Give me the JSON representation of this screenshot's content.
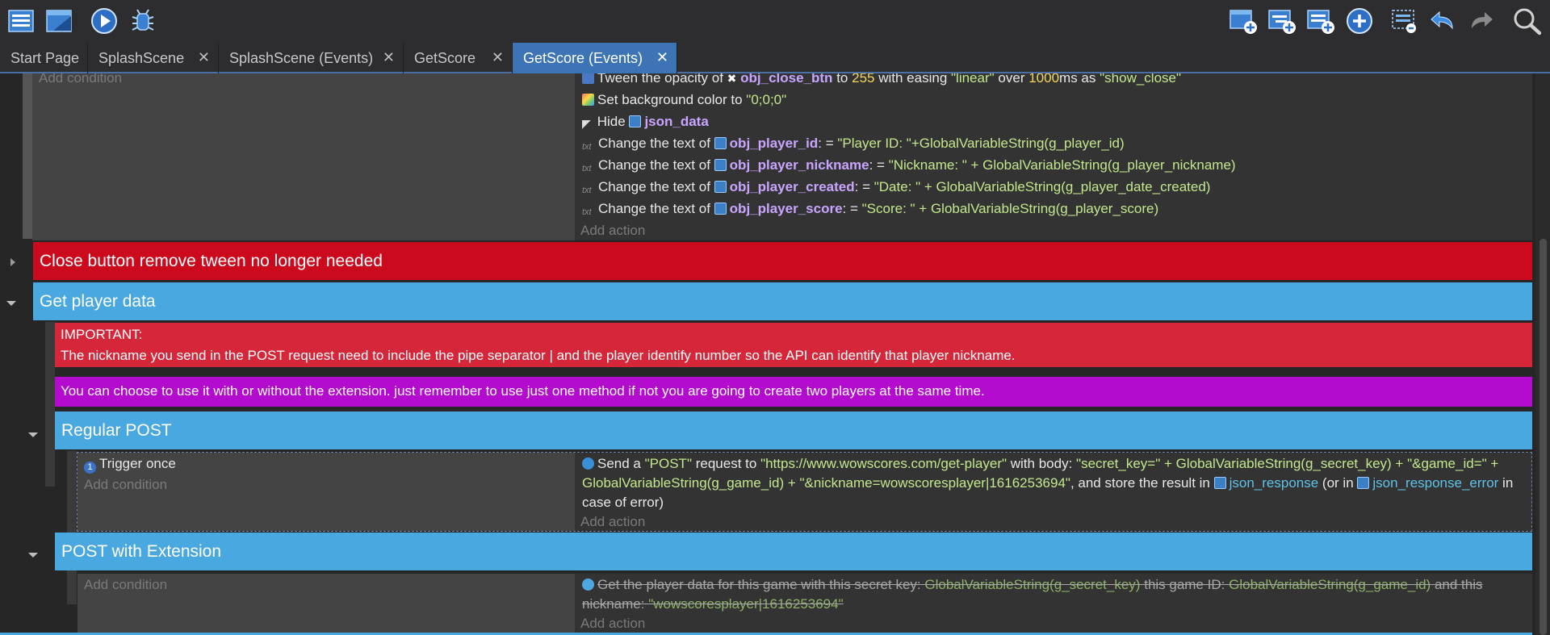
{
  "toolbar": {
    "left_icons": [
      "events-list-icon",
      "scene-window-icon",
      "play-preview-icon",
      "debug-bug-icon"
    ],
    "right_icons": [
      "add-event-icon",
      "add-subevent-icon",
      "add-other-icon",
      "add-plus-icon",
      "choose-block-icon",
      "undo-icon",
      "redo-icon",
      "search-icon"
    ]
  },
  "tabs": [
    {
      "label": "Start Page",
      "closable": false
    },
    {
      "label": "SplashScene",
      "closable": true
    },
    {
      "label": "SplashScene (Events)",
      "closable": true
    },
    {
      "label": "GetScore",
      "closable": true
    },
    {
      "label": "GetScore (Events)",
      "closable": true,
      "active": true
    }
  ],
  "tab_close_glyph": "✕",
  "colors": {
    "accent_tab": "#3c74b6",
    "group_red": "#cc0a1e",
    "group_blue": "#4aa8e0",
    "comment_red": "#d62639",
    "comment_purple": "#b40ccf"
  },
  "events": {
    "top_event": {
      "add_condition": "Add condition",
      "add_action": "Add action",
      "actions": [
        {
          "icon": "tween-icon",
          "prefix": "Tween the opacity of",
          "object_icon": "close-x-icon",
          "object": "obj_close_btn",
          "mid1": "to",
          "value": "255",
          "mid2": "with easing",
          "easing": "\"linear\"",
          "mid3": "over",
          "duration": "1000",
          "mid4": "ms as",
          "id": "\"show_close\""
        },
        {
          "icon": "color-icon",
          "prefix": "Set background color to",
          "value": "\"0;0;0\""
        },
        {
          "icon": "hide-icon",
          "prefix": "Hide",
          "object": "json_data"
        },
        {
          "icon": "text-icon",
          "prefix": "Change the text of",
          "object": "obj_player_id",
          "op": ": =",
          "value": "\"Player ID: \"+GlobalVariableString(g_player_id)"
        },
        {
          "icon": "text-icon",
          "prefix": "Change the text of",
          "object": "obj_player_nickname",
          "op": ": =",
          "value": "\"Nickname: \" + GlobalVariableString(g_player_nickname)"
        },
        {
          "icon": "text-icon",
          "prefix": "Change the text of",
          "object": "obj_player_created",
          "op": ": =",
          "value": "\"Date: \" + GlobalVariableString(g_player_date_created)"
        },
        {
          "icon": "text-icon",
          "prefix": "Change the text of",
          "object": "obj_player_score",
          "op": ": =",
          "value": "\"Score: \" + GlobalVariableString(g_player_score)"
        }
      ]
    },
    "group_close": {
      "title": "Close button remove tween no longer needed"
    },
    "group_get": {
      "title": "Get player data"
    },
    "comment_important": {
      "line1": "IMPORTANT:",
      "line2": "The nickname you send in the POST request need to include the pipe separator | and the player identify number so the API can identify that player nickname."
    },
    "comment_choose": {
      "text": "You can choose to use it with or without the extension. just remember to use just one method if not you are going to create two players at the same time."
    },
    "group_regular": {
      "title": "Regular POST"
    },
    "regular_event": {
      "condition": "Trigger once",
      "add_condition": "Add condition",
      "add_action": "Add action",
      "action": {
        "p1": "Send a",
        "method": "\"POST\"",
        "p2": "request to",
        "url": "\"https://www.wowscores.com/get-player\"",
        "p3": "with body:",
        "b1": "\"secret_key=\"",
        "b2": "+ GlobalVariableString(g_secret_key) +",
        "b3": "\"&game_id=\"",
        "b4": "+ GlobalVariableString(g_game_id) +",
        "b5": "\"&nickname=wowscoresplayer|1616253694\"",
        "p4": ", and store the result in",
        "var1": "json_response",
        "p5": "(or in",
        "var2": "json_response_error",
        "p6": "in case of error)"
      }
    },
    "group_ext": {
      "title": "POST with Extension"
    },
    "ext_event": {
      "add_condition": "Add condition",
      "add_action": "Add action",
      "action": {
        "p1": "Get the player data for this game with this secret key:",
        "key": "GlobalVariableString(g_secret_key)",
        "p2": "this game ID:",
        "game": "GlobalVariableString(g_game_id)",
        "p3": "and this nickname:",
        "nick": "\"wowscoresplayer|1616253694\""
      }
    }
  }
}
